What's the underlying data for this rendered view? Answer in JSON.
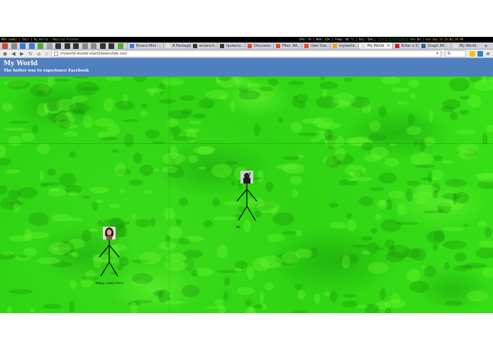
{
  "system_bar": {
    "workspace": "MSF [web]",
    "layout": "Tall",
    "window_title": "My World - Mozilla Firefox",
    "cpu": "CPU: 7% | Mem: 22% | Temp: 50 °C | Vol: 56%",
    "battery_bars": "|||||||||||||||||| 99%",
    "battery_state": "On",
    "date": "Sun Sep 14",
    "time": "21:01:16 AM"
  },
  "tabs": [
    {
      "label": "Emacs Mini ...",
      "color": "#3b7bd1"
    },
    {
      "label": "A Package in...",
      "color": "#e0e0e0"
    },
    {
      "label": "emacs-h...",
      "color": "#333333"
    },
    {
      "label": "iquiw/co...",
      "color": "#333333"
    },
    {
      "label": "Discussio...",
      "color": "#e34b2a"
    },
    {
      "label": "Files: AA...",
      "color": "#e34b2a"
    },
    {
      "label": "User Das...",
      "color": "#e34b2a"
    },
    {
      "label": "myworld...",
      "color": "#f0a020"
    },
    {
      "label": "My World",
      "color": "#e0e0e0",
      "active": true
    },
    {
      "label": "Enter a S...",
      "color": "#d02020"
    },
    {
      "label": "Graph AP...",
      "color": "#3b5998"
    },
    {
      "label": "My World",
      "color": "#e0e0e0"
    }
  ],
  "pinned_colors": [
    "#d44638",
    "#888888",
    "#3b7bd1",
    "#3b7bd1",
    "#55aa33",
    "#9aa0a8",
    "#333333",
    "#333333",
    "#333333",
    "#888888",
    "#888888",
    "#333333",
    "#333333",
    "#55aa33"
  ],
  "toolbar": {
    "url": "myworld-docker.elasticbeanstalk.com",
    "search_placeholder": "G",
    "new_tab": "+"
  },
  "page": {
    "title": "My World",
    "tagline": "The better way to experience Facebook"
  },
  "people": [
    {
      "name": "Me",
      "avatar": "dark"
    },
    {
      "name": "Hadya Cokely Parra",
      "avatar": "woman"
    }
  ]
}
